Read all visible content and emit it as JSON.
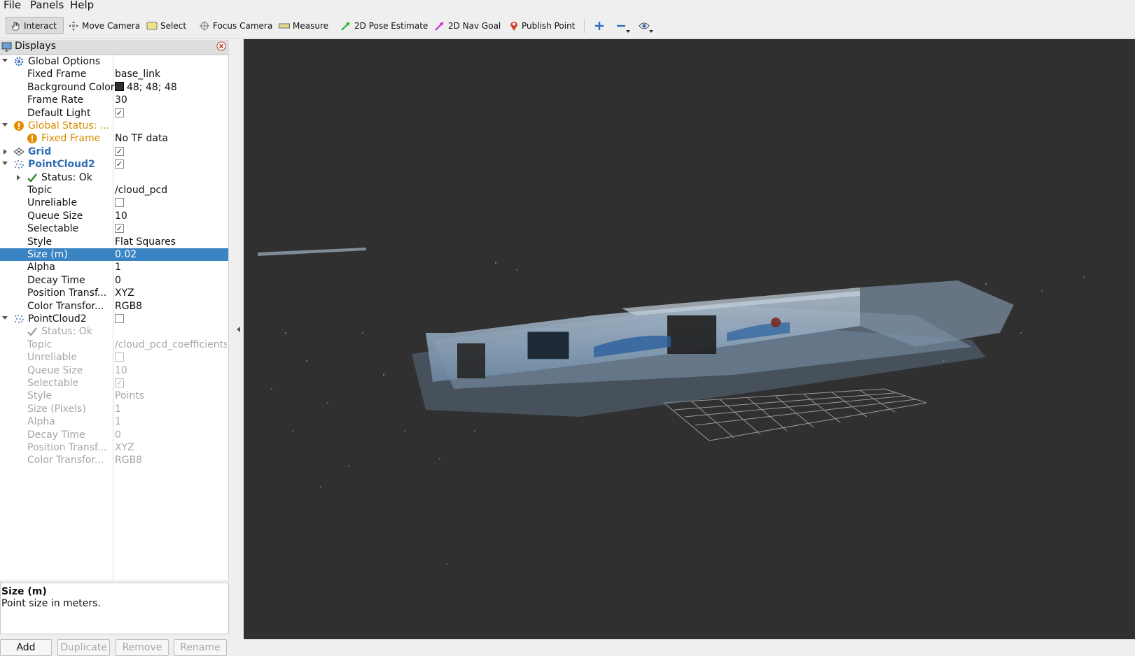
{
  "menu": [
    "File",
    "Panels",
    "Help"
  ],
  "toolbar": {
    "interact": "Interact",
    "move_camera": "Move Camera",
    "select": "Select",
    "focus_camera": "Focus Camera",
    "measure": "Measure",
    "pose_estimate": "2D Pose Estimate",
    "nav_goal": "2D Nav Goal",
    "publish_point": "Publish Point"
  },
  "panel": {
    "title": "Displays",
    "rows": [
      {
        "name": "Global Options",
        "value": ""
      },
      {
        "name": "Fixed Frame",
        "value": "base_link"
      },
      {
        "name": "Background Color",
        "value": "48; 48; 48"
      },
      {
        "name": "Frame Rate",
        "value": "30"
      },
      {
        "name": "Default Light",
        "value": ""
      },
      {
        "name": "Global Status: ...",
        "value": ""
      },
      {
        "name": "Fixed Frame",
        "value": "No TF data"
      },
      {
        "name": "Grid",
        "value": ""
      },
      {
        "name": "PointCloud2",
        "value": ""
      },
      {
        "name": "Status: Ok",
        "value": ""
      },
      {
        "name": "Topic",
        "value": "/cloud_pcd"
      },
      {
        "name": "Unreliable",
        "value": ""
      },
      {
        "name": "Queue Size",
        "value": "10"
      },
      {
        "name": "Selectable",
        "value": ""
      },
      {
        "name": "Style",
        "value": "Flat Squares"
      },
      {
        "name": "Size (m)",
        "value": "0.02"
      },
      {
        "name": "Alpha",
        "value": "1"
      },
      {
        "name": "Decay Time",
        "value": "0"
      },
      {
        "name": "Position Transf...",
        "value": "XYZ"
      },
      {
        "name": "Color Transfor...",
        "value": "RGB8"
      },
      {
        "name": "PointCloud2",
        "value": ""
      },
      {
        "name": "Status: Ok",
        "value": ""
      },
      {
        "name": "Topic",
        "value": "/cloud_pcd_coefficients"
      },
      {
        "name": "Unreliable",
        "value": ""
      },
      {
        "name": "Queue Size",
        "value": "10"
      },
      {
        "name": "Selectable",
        "value": ""
      },
      {
        "name": "Style",
        "value": "Points"
      },
      {
        "name": "Size (Pixels)",
        "value": "1"
      },
      {
        "name": "Alpha",
        "value": "1"
      },
      {
        "name": "Decay Time",
        "value": "0"
      },
      {
        "name": "Position Transf...",
        "value": "XYZ"
      },
      {
        "name": "Color Transfor...",
        "value": "RGB8"
      }
    ],
    "checks": {
      "default_light": true,
      "grid": true,
      "pointcloud1": true,
      "unreliable1": false,
      "selectable1": true,
      "pointcloud2": false,
      "unreliable2": false,
      "selectable2": true
    },
    "description": {
      "title": "Size (m)",
      "text": "Point size in meters."
    },
    "buttons": {
      "add": "Add",
      "duplicate": "Duplicate",
      "remove": "Remove",
      "rename": "Rename"
    }
  },
  "colors": {
    "background": "#303030",
    "selection": "#3a84c4",
    "warning": "#d98c00",
    "display_name": "#2f6eb5"
  },
  "icons": [
    "hand-icon",
    "move-camera-icon",
    "select-icon",
    "focus-camera-icon",
    "measure-icon",
    "pose-arrow-icon",
    "nav-goal-icon",
    "map-pin-icon",
    "plus-icon",
    "minus-icon",
    "eye-icon",
    "monitor-icon",
    "close-icon",
    "gear-icon",
    "warning-icon",
    "grid-icon",
    "pointcloud-icon",
    "checkmark-icon"
  ]
}
